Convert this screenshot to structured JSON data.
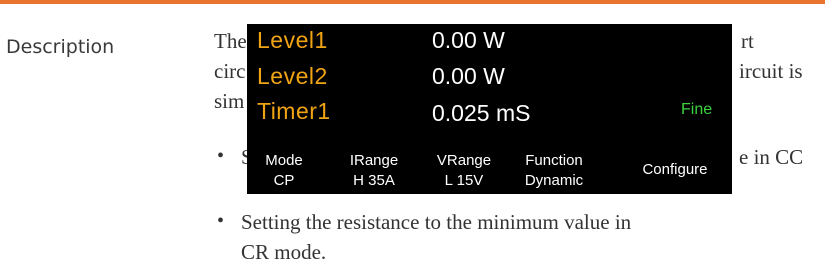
{
  "section": {
    "label": "Description"
  },
  "body": {
    "line1_start": "The",
    "line1_end": "rt",
    "line2_start": "circ",
    "line2_end": "ircuit is",
    "line3_start": "sim",
    "bullet1_start": "S",
    "bullet1_end": "e in CC",
    "bullet2_line1": "Setting the resistance to the minimum value in",
    "bullet2_line2": "CR mode.",
    "bullet_glyph": "•"
  },
  "display": {
    "rows": [
      {
        "name": "Level1",
        "value": "0.00 W"
      },
      {
        "name": "Level2",
        "value": "0.00 W"
      },
      {
        "name": "Timer1",
        "value": "0.025 mS"
      }
    ],
    "adjust_mode": "Fine",
    "softkeys": [
      {
        "line1": "Mode",
        "line2": "CP"
      },
      {
        "line1": "IRange",
        "line2": "H 35A"
      },
      {
        "line1": "VRange",
        "line2": "L 15V"
      },
      {
        "line1": "Function",
        "line2": "Dynamic"
      }
    ],
    "configure_label": "Configure"
  },
  "colors": {
    "accent_rule": "#e8742e",
    "param_name": "#f0a414",
    "param_value": "#ffffff",
    "fine": "#3cd23c",
    "display_bg": "#000000"
  }
}
